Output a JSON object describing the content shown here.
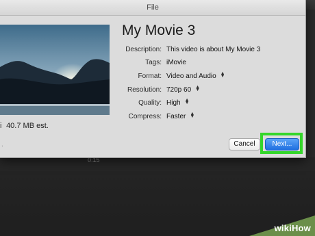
{
  "window": {
    "title": "File"
  },
  "movie": {
    "title": "My Movie 3"
  },
  "fields": {
    "description": {
      "label": "Description:",
      "value": "This video is about My Movie 3"
    },
    "tags": {
      "label": "Tags:",
      "value": "iMovie"
    },
    "format": {
      "label": "Format:",
      "value": "Video and Audio"
    },
    "resolution": {
      "label": "Resolution:",
      "value": "720p 60"
    },
    "quality": {
      "label": "Quality:",
      "value": "High"
    },
    "compress": {
      "label": "Compress:",
      "value": "Faster"
    }
  },
  "size_estimate": "40.7 MB est.",
  "buttons": {
    "cancel": "Cancel",
    "next": "Next..."
  },
  "timeline": {
    "timecode": "0:15"
  },
  "watermark": {
    "text": "wikiHow"
  },
  "colors": {
    "highlight": "#34d62a",
    "primary_button": "#2a7ae6"
  },
  "icons": {
    "stepper": "up-down-arrows-icon",
    "size": "file-size-icon"
  }
}
